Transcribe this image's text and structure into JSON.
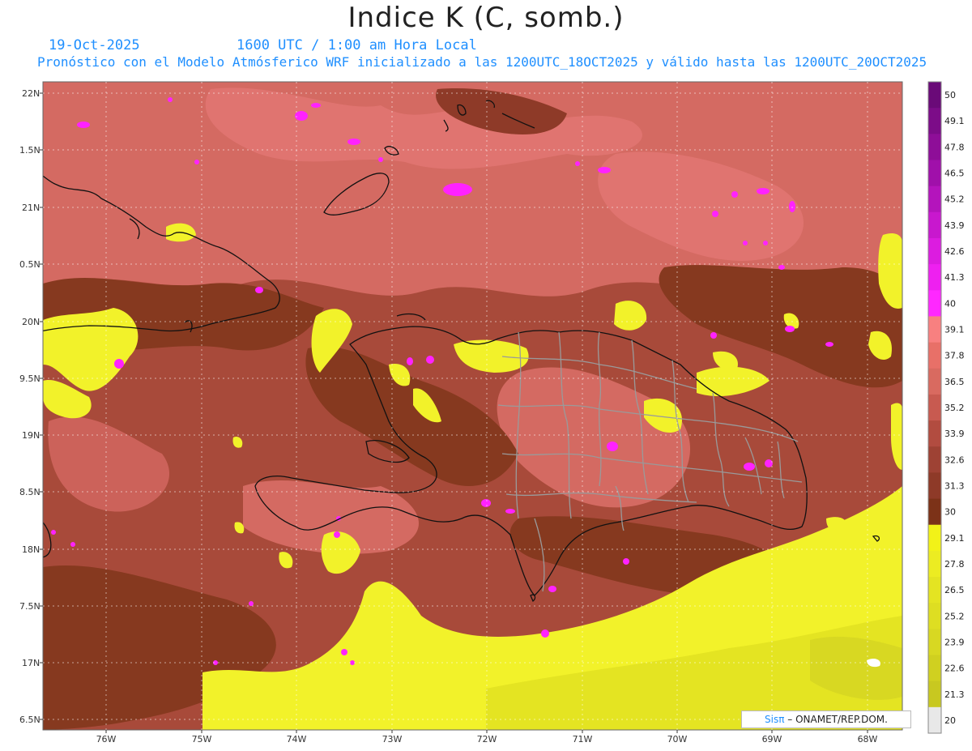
{
  "header": {
    "title": "Indice K (C, somb.)",
    "date": "19-Oct-2025",
    "time": "1600 UTC / 1:00 am Hora Local",
    "description": "Pronóstico con el Modelo Atmósferico WRF inicializado a las 1200UTC_18OCT2025 y válido hasta las  1200UTC_20OCT2025"
  },
  "map": {
    "lat_labels": [
      "22N",
      "1.5N",
      "21N",
      "0.5N",
      "20N",
      "9.5N",
      "19N",
      "8.5N",
      "18N",
      "7.5N",
      "17N",
      "6.5N"
    ],
    "lon_labels": [
      "76W",
      "75W",
      "74W",
      "73W",
      "72W",
      "71W",
      "70W",
      "69W",
      "68W"
    ],
    "colors": {
      "dark_brown": "#86391f",
      "mid_brown": "#a84a3a",
      "salmon": "#d46a62",
      "pink": "#f07a78",
      "magenta": "#ff22ff",
      "yellow": "#f2f22a",
      "coast": "#111111",
      "borders": "#9a9a9a"
    }
  },
  "colorbar": {
    "labels": [
      "50",
      "49.1",
      "47.8",
      "46.5",
      "45.2",
      "43.9",
      "42.6",
      "41.3",
      "40",
      "39.1",
      "37.8",
      "36.5",
      "35.2",
      "33.9",
      "32.6",
      "31.3",
      "30",
      "29.1",
      "27.8",
      "26.5",
      "25.2",
      "23.9",
      "22.6",
      "21.3",
      "20"
    ],
    "colors": [
      "#6a0a78",
      "#7c0c88",
      "#8e0e98",
      "#a010aa",
      "#b414bc",
      "#c818ce",
      "#dc1ce0",
      "#ee20f0",
      "#ff28ff",
      "#f88080",
      "#e87068",
      "#d96a60",
      "#c85a50",
      "#b24c40",
      "#9e4234",
      "#8e3a28",
      "#7c3218",
      "#f2f218",
      "#ecec22",
      "#e4e422",
      "#dede22",
      "#d8d822",
      "#d0d020",
      "#c8c820",
      "#e8e8e8"
    ]
  },
  "credit": {
    "logo": "Sisπ",
    "text": " – ONAMET/REP.DOM."
  }
}
